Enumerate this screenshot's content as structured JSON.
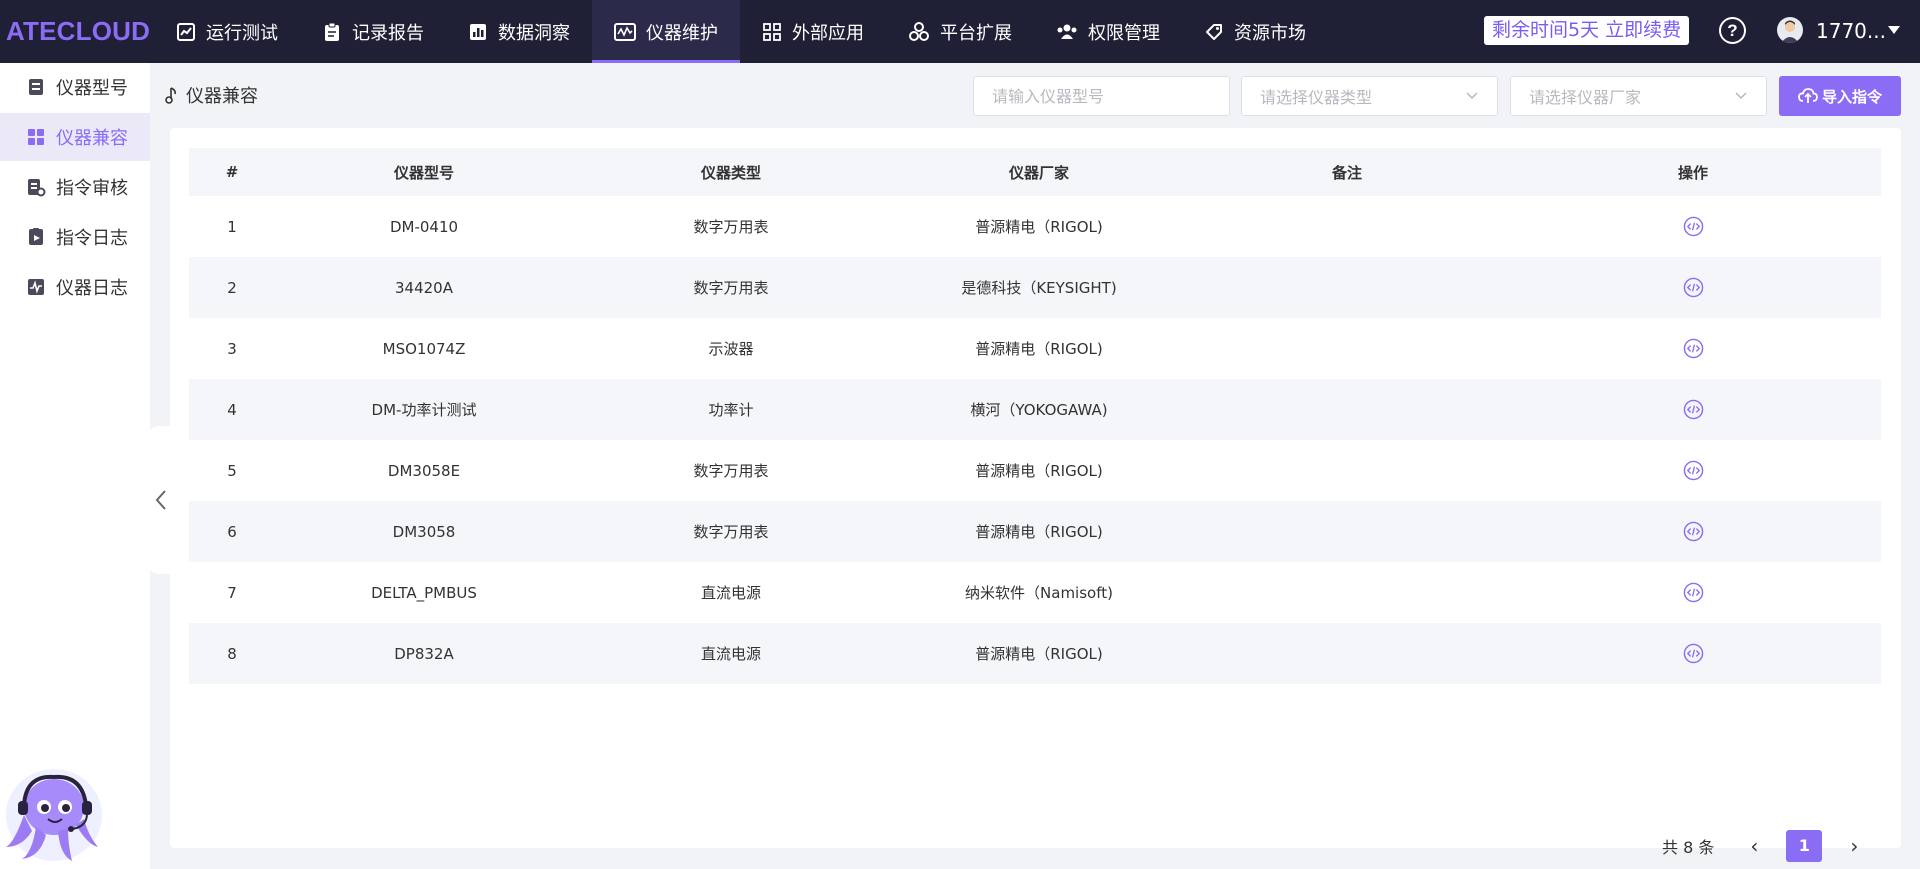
{
  "app": {
    "logo": "ATECLOUD"
  },
  "nav": {
    "items": [
      {
        "label": "运行测试",
        "icon": "chart-line-icon"
      },
      {
        "label": "记录报告",
        "icon": "clipboard-icon"
      },
      {
        "label": "数据洞察",
        "icon": "bar-chart-icon"
      },
      {
        "label": "仪器维护",
        "icon": "oscilloscope-icon",
        "active": true
      },
      {
        "label": "外部应用",
        "icon": "grid-icon"
      },
      {
        "label": "平台扩展",
        "icon": "cubes-icon"
      },
      {
        "label": "权限管理",
        "icon": "users-icon"
      },
      {
        "label": "资源市场",
        "icon": "tag-icon"
      }
    ],
    "renew": "剩余时间5天 立即续费",
    "help": "?",
    "user": "1770..."
  },
  "sidebar": {
    "items": [
      {
        "label": "仪器型号",
        "icon": "model-icon"
      },
      {
        "label": "仪器兼容",
        "icon": "compat-icon",
        "active": true
      },
      {
        "label": "指令审核",
        "icon": "audit-icon"
      },
      {
        "label": "指令日志",
        "icon": "log-play-icon"
      },
      {
        "label": "仪器日志",
        "icon": "pulse-icon"
      }
    ]
  },
  "page": {
    "breadcrumb": "仪器兼容",
    "search_placeholder": "请输入仪器型号",
    "type_placeholder": "请选择仪器类型",
    "vendor_placeholder": "请选择仪器厂家",
    "import_label": "导入指令"
  },
  "table": {
    "headers": {
      "index": "#",
      "model": "仪器型号",
      "type": "仪器类型",
      "vendor": "仪器厂家",
      "note": "备注",
      "op": "操作"
    },
    "rows": [
      {
        "index": "1",
        "model": "DM-0410",
        "type": "数字万用表",
        "vendor": "普源精电（RIGOL)",
        "note": ""
      },
      {
        "index": "2",
        "model": "34420A",
        "type": "数字万用表",
        "vendor": "是德科技（KEYSIGHT)",
        "note": ""
      },
      {
        "index": "3",
        "model": "MSO1074Z",
        "type": "示波器",
        "vendor": "普源精电（RIGOL)",
        "note": ""
      },
      {
        "index": "4",
        "model": "DM-功率计测试",
        "type": "功率计",
        "vendor": "横河（YOKOGAWA)",
        "note": ""
      },
      {
        "index": "5",
        "model": "DM3058E",
        "type": "数字万用表",
        "vendor": "普源精电（RIGOL)",
        "note": ""
      },
      {
        "index": "6",
        "model": "DM3058",
        "type": "数字万用表",
        "vendor": "普源精电（RIGOL)",
        "note": ""
      },
      {
        "index": "7",
        "model": "DELTA_PMBUS",
        "type": "直流电源",
        "vendor": "纳米软件（Namisoft)",
        "note": ""
      },
      {
        "index": "8",
        "model": "DP832A",
        "type": "直流电源",
        "vendor": "普源精电（RIGOL)",
        "note": ""
      }
    ]
  },
  "pagination": {
    "total": "共 8 条",
    "current": "1",
    "prev": "‹",
    "next": "›"
  },
  "colors": {
    "accent": "#8a6cf5",
    "topbar": "#1f1f36",
    "row_alt": "#f5f6fa"
  }
}
